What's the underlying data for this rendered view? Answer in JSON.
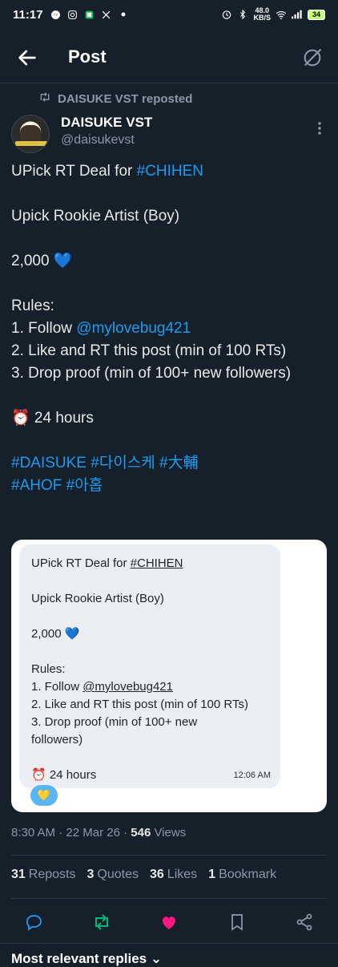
{
  "status_bar": {
    "time": "11:17",
    "net_speed_value": "48.0",
    "net_speed_unit": "KB/S",
    "battery": "34"
  },
  "header": {
    "title": "Post"
  },
  "repost": {
    "label": "DAISUKE VST reposted"
  },
  "author": {
    "name": "DAISUKE VST",
    "handle": "@daisukevst"
  },
  "post": {
    "line1_prefix": "UPick RT Deal for ",
    "line1_tag": "#CHIHEN",
    "line2": "Upick Rookie Artist (Boy)",
    "line3": "2,000 💙",
    "rules_label": "Rules:",
    "rule1_prefix": "1. Follow ",
    "rule1_mention": "@mylovebug421",
    "rule2": "2. Like and RT this post (min of 100 RTs)",
    "rule3": "3. Drop proof (min of 100+ new followers)",
    "duration": "⏰ 24 hours",
    "tags": [
      "#DAISUKE",
      "#다이스케",
      "#大輔",
      "#AHOF",
      "#아홉"
    ]
  },
  "media": {
    "line1_prefix": "UPick RT Deal for ",
    "line1_tag": "#CHIHEN",
    "line2": "Upick Rookie Artist (Boy)",
    "line3": "2,000 💙",
    "rules_label": "Rules:",
    "rule1_prefix": "1. Follow ",
    "rule1_mention": "@mylovebug421",
    "rule2": "2. Like and RT this post (min of 100 RTs)",
    "rule3_a": "3. Drop proof (min of 100+ new",
    "rule3_b": "followers)",
    "duration": "⏰ 24 hours",
    "timestamp": "12:06 AM",
    "reaction": "💛"
  },
  "meta": {
    "time": "8:30 AM",
    "separator": "·",
    "date": "22 Mar 26",
    "views_count": "546",
    "views_label": "Views"
  },
  "stats": {
    "reposts_count": "31",
    "reposts_label": "Reposts",
    "quotes_count": "3",
    "quotes_label": "Quotes",
    "likes_count": "36",
    "likes_label": "Likes",
    "bookmarks_count": "1",
    "bookmarks_label": "Bookmark"
  },
  "replies": {
    "label": "Most relevant replies ⌄"
  },
  "colors": {
    "background": "#15202b",
    "link": "#1d9bf0",
    "repost_active": "#00ba7c",
    "like_active": "#f91880"
  }
}
